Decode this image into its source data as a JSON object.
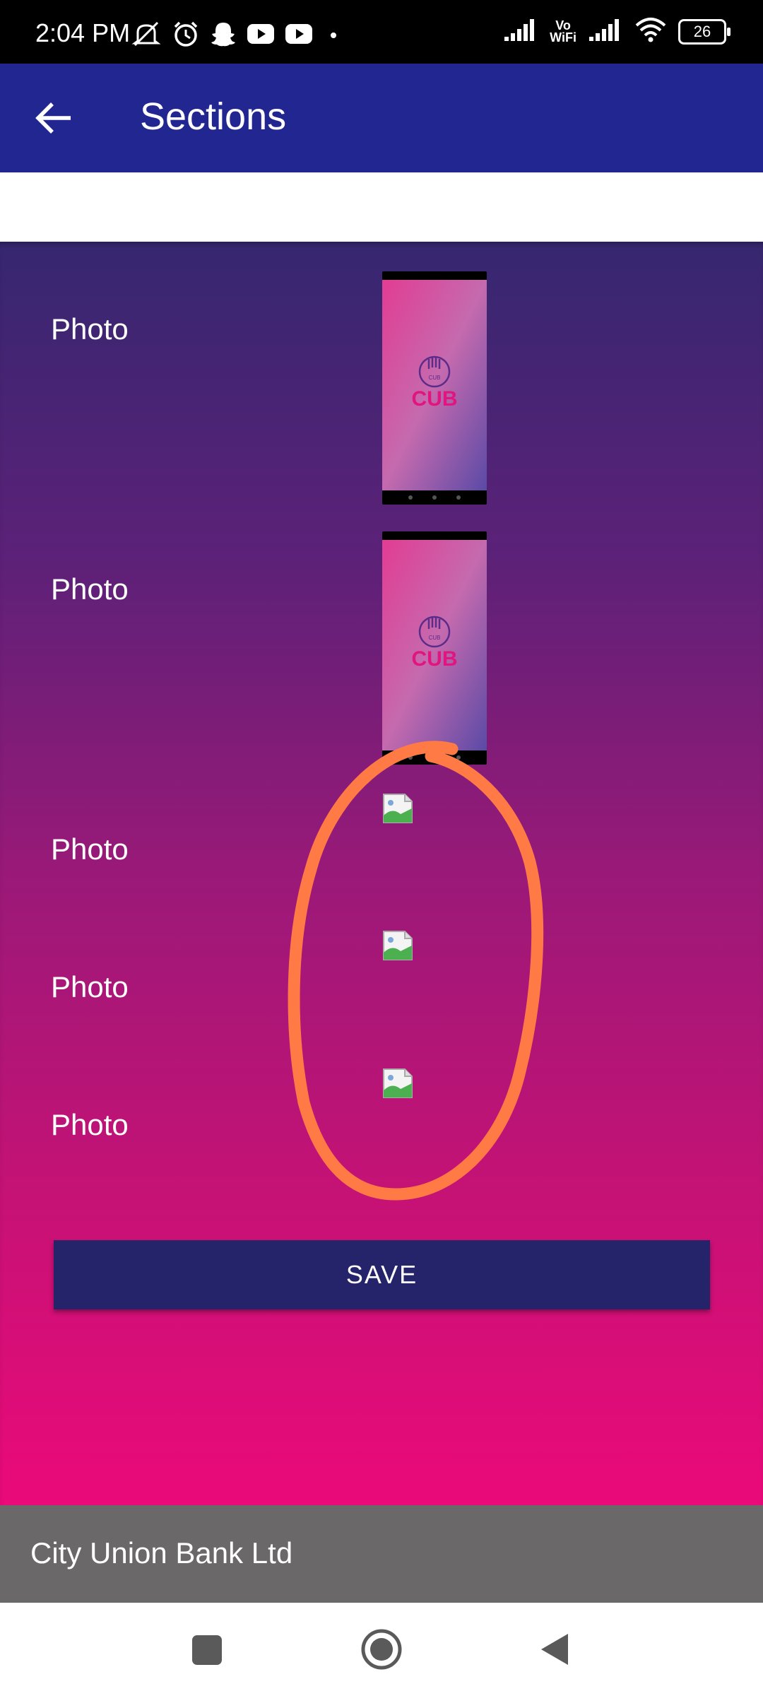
{
  "status_bar": {
    "time": "2:04 PM",
    "battery": "26",
    "vowifi_top": "Vo",
    "vowifi_bottom": "WiFi",
    "left_icons": [
      "mute-icon",
      "alarm-icon",
      "snapchat-icon",
      "youtube-icon",
      "youtube-icon",
      "dot-icon"
    ],
    "right_icons": [
      "signal-icon",
      "vowifi-icon",
      "signal-icon",
      "wifi-icon",
      "battery-icon"
    ]
  },
  "app_bar": {
    "title": "Sections",
    "back_icon": "arrow-left-icon",
    "color": "#222690"
  },
  "rows": [
    {
      "label": "Photo",
      "image": "cub-screenshot"
    },
    {
      "label": "Photo",
      "image": "cub-screenshot"
    },
    {
      "label": "Photo",
      "image": "broken-image"
    },
    {
      "label": "Photo",
      "image": "broken-image"
    },
    {
      "label": "Photo",
      "image": "broken-image"
    }
  ],
  "thumbnail": {
    "logo_text": "CUB",
    "emblem_text": "CUB"
  },
  "save_button": {
    "label": "SAVE",
    "color": "#25236a"
  },
  "footer": {
    "text": "City Union Bank Ltd"
  },
  "nav_bar": {
    "icons": [
      "recents-square-icon",
      "home-circle-icon",
      "back-triangle-icon"
    ]
  },
  "annotation": {
    "shape": "hand-drawn-ellipse",
    "color": "#ff7a45"
  }
}
